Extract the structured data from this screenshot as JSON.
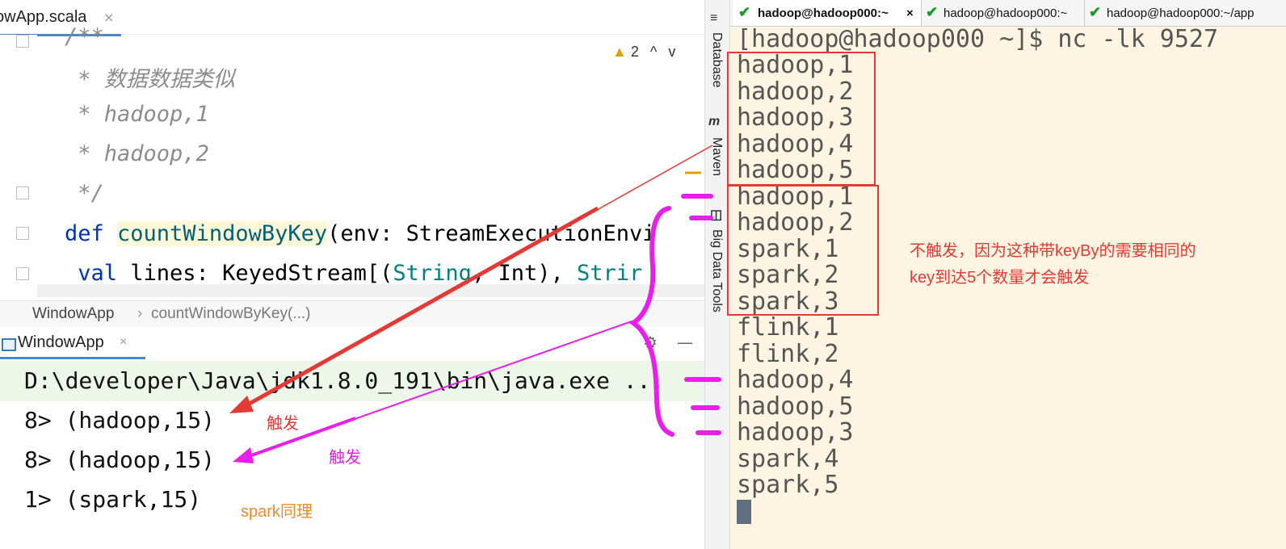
{
  "editor": {
    "file_tab": "owApp.scala",
    "tab_close": "×",
    "code_lines": {
      "l0": "/**",
      "l1": " * 数据数据类似",
      "l2": " * hadoop,1",
      "l3": " * hadoop,2",
      "l4": " */",
      "def_kw": "def ",
      "def_fn": "countWindowByKey",
      "def_rest": "(env: StreamExecutionEnvi",
      "val_kw": " val ",
      "val_rest": "lines: KeyedStream[(",
      "val_type1": "String",
      "val_mid": ", Int), ",
      "val_type2": "Strir"
    },
    "inspection_count": "2",
    "inspection_up": "^",
    "inspection_down": "v"
  },
  "breadcrumb": {
    "class": "WindowApp",
    "sep": "›",
    "method": "countWindowByKey(...)"
  },
  "run": {
    "tab_label": "WindowApp",
    "tab_close": "×",
    "gear": "⚙",
    "minimize": "—",
    "command": "D:\\developer\\Java\\jdk1.8.0_191\\bin\\java.exe ...",
    "output": [
      "8> (hadoop,15)",
      "8> (hadoop,15)",
      "1> (spark,15)"
    ]
  },
  "toolstrip": {
    "database": "Database",
    "maven_icon": "m",
    "maven": "Maven",
    "bigdata": "Big Data Tools"
  },
  "terminal": {
    "tabs": [
      "hadoop@hadoop000:~",
      "hadoop@hadoop000:~",
      "hadoop@hadoop000:~/app"
    ],
    "active_tab_close": "×",
    "prompt": "[hadoop@hadoop000 ~]$ nc -lk 9527",
    "lines": [
      "hadoop,1",
      "hadoop,2",
      "hadoop,3",
      "hadoop,4",
      "hadoop,5",
      "hadoop,1",
      "hadoop,2",
      "spark,1",
      "spark,2",
      "spark,3",
      "flink,1",
      "flink,2",
      "hadoop,4",
      "hadoop,5",
      "hadoop,3",
      "spark,4",
      "spark,5"
    ]
  },
  "annotations": {
    "trigger_red": "触发",
    "trigger_magenta": "触发",
    "spark_same": "spark同理",
    "note_line1": "不触发，因为这种带keyBy的需要相同的",
    "note_line2": "key到达5个数量才会触发"
  },
  "colors": {
    "annotation_red": "#e53935",
    "annotation_magenta": "#e91ee8",
    "annotation_orange": "#ef8a2a",
    "terminal_bg": "#fdf5e2"
  }
}
